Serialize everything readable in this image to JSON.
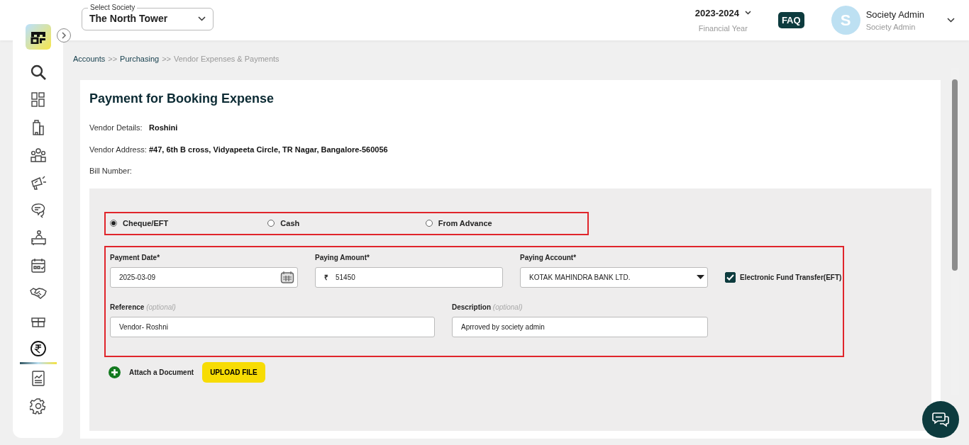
{
  "sidebar": {
    "items": [
      {
        "kind": "search",
        "selected": false
      },
      {
        "kind": "grid",
        "selected": false
      },
      {
        "kind": "building",
        "selected": false
      },
      {
        "kind": "people",
        "selected": false
      },
      {
        "kind": "megaphone",
        "selected": false
      },
      {
        "kind": "chat",
        "selected": false
      },
      {
        "kind": "desk",
        "selected": false
      },
      {
        "kind": "calendar",
        "selected": false
      },
      {
        "kind": "handshake",
        "selected": false
      },
      {
        "kind": "gift",
        "selected": false
      },
      {
        "kind": "rupee",
        "selected": true
      },
      {
        "kind": "report",
        "selected": false
      },
      {
        "kind": "gear",
        "selected": false
      }
    ]
  },
  "header": {
    "society_select": {
      "label": "Select Society",
      "value": "The North Tower"
    },
    "financial_year": {
      "value": "2023-2024",
      "label": "Financial Year"
    },
    "faq": "FAQ",
    "user": {
      "initial": "S",
      "name": "Society Admin",
      "role": "Society Admin"
    }
  },
  "breadcrumb": {
    "separator": ">>",
    "items": [
      {
        "text": "Accounts",
        "current": false
      },
      {
        "text": "Purchasing",
        "current": false
      },
      {
        "text": "Vendor Expenses & Payments",
        "current": true
      }
    ]
  },
  "title": "Payment for Booking Expense",
  "details": [
    {
      "label": "Vendor Details:",
      "value": "Roshini"
    },
    {
      "label": "Vendor Address:",
      "value": "#47, 6th B cross, Vidyapeeta Circle, TR Nagar, Bangalore-560056"
    },
    {
      "label": "Bill Number:"
    }
  ],
  "payment_modes": [
    {
      "label": "Cheque/EFT",
      "selected": true
    },
    {
      "label": "Cash",
      "selected": false
    },
    {
      "label": "From Advance",
      "selected": false
    }
  ],
  "form": {
    "payment_date": {
      "label": "Payment Date*",
      "value": "2025-03-09"
    },
    "paying_amount": {
      "label": "Paying Amount*",
      "currency": "₹",
      "value": "51450"
    },
    "paying_account": {
      "label": "Paying Account*",
      "value": "KOTAK MAHINDRA BANK LTD."
    },
    "eft": {
      "label": "Electronic Fund Transfer(EFT)",
      "checked": true
    },
    "reference": {
      "label": "Reference",
      "hint": "(optional)",
      "value": "Vendor- Roshni"
    },
    "description": {
      "label": "Description",
      "hint": "(optional)",
      "value": "Aprroved by society admin"
    }
  },
  "attach": {
    "label": "Attach a Document",
    "button": "UPLOAD FILE"
  }
}
